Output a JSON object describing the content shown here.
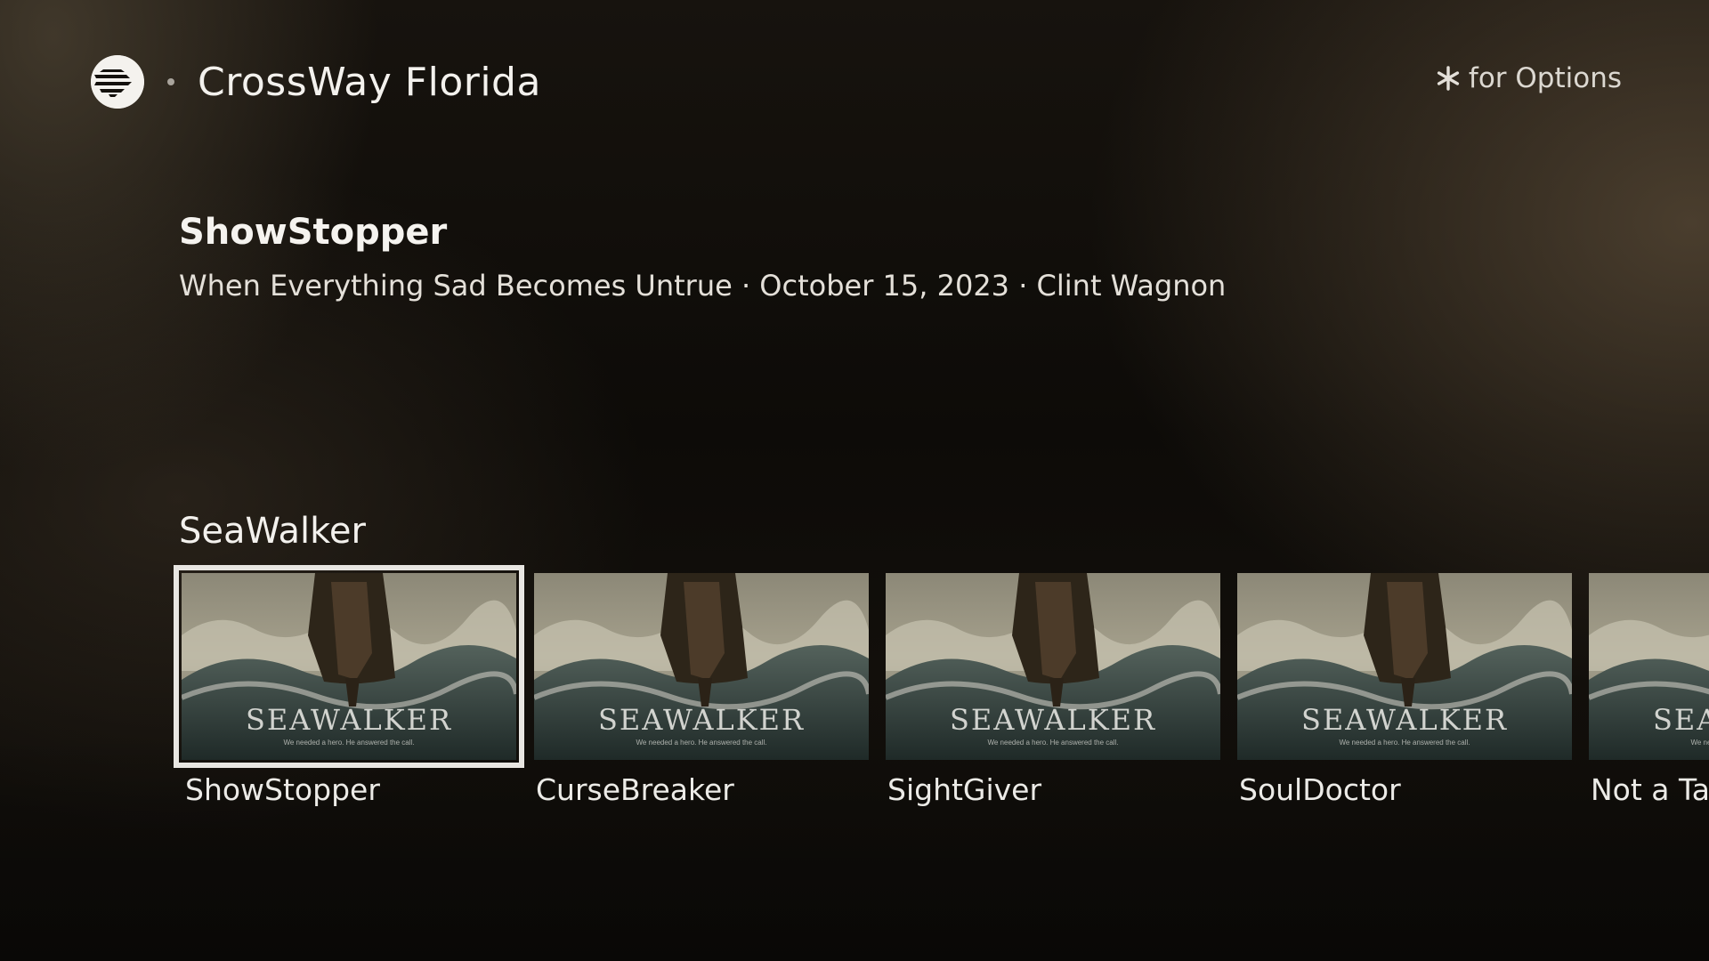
{
  "header": {
    "app_title": "CrossWay Florida",
    "options_hint": "for Options",
    "logo_icon": "crossway-logo-icon",
    "options_icon": "asterisk-icon"
  },
  "feature": {
    "title": "ShowStopper",
    "meta": "When Everything Sad Becomes Untrue · October 15, 2023 · Clint Wagnon"
  },
  "row": {
    "title": "SeaWalker",
    "tiles": [
      {
        "label": "ShowStopper",
        "art_title": "SEAWALKER",
        "art_tagline": "We needed a hero. He answered the call.",
        "focused": true
      },
      {
        "label": "CurseBreaker",
        "art_title": "SEAWALKER",
        "art_tagline": "We needed a hero. He answered the call.",
        "focused": false
      },
      {
        "label": "SightGiver",
        "art_title": "SEAWALKER",
        "art_tagline": "We needed a hero. He answered the call.",
        "focused": false
      },
      {
        "label": "SoulDoctor",
        "art_title": "SEAWALKER",
        "art_tagline": "We needed a hero. He answered the call.",
        "focused": false
      },
      {
        "label": "Not a Ta",
        "art_title": "SEAWALKER",
        "art_tagline": "We needed a hero. He answered the call.",
        "focused": false
      }
    ]
  },
  "colors": {
    "background": "#100d09",
    "focus_border": "#e8e6e2",
    "text_primary": "#f3f1ed"
  }
}
